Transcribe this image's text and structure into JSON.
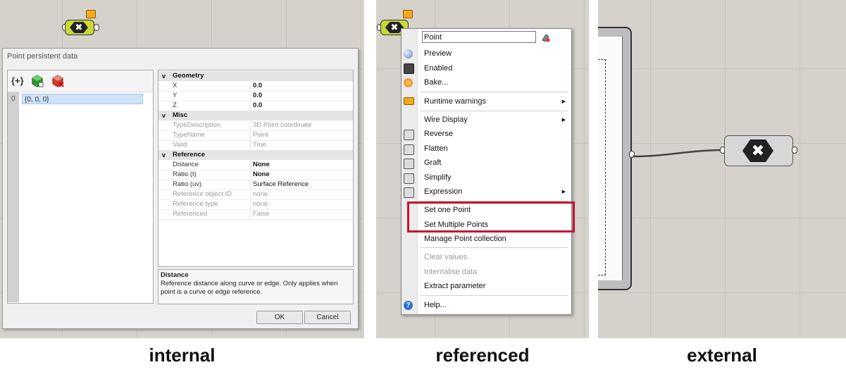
{
  "captions": [
    "internal",
    "referenced",
    "external"
  ],
  "node_glyph": "✖",
  "dialog": {
    "title": "Point persistent data",
    "list_item_index": "0",
    "list_item_value": "{0, 0, 0}",
    "toolbar_icons": [
      "add-braces-icon",
      "green-cube-icon",
      "red-cube-icon"
    ],
    "sections": {
      "geometry": "Geometry",
      "misc": "Misc",
      "reference": "Reference"
    },
    "geometry": [
      {
        "k": "X",
        "v": "0.0"
      },
      {
        "k": "Y",
        "v": "0.0"
      },
      {
        "k": "Z",
        "v": "0.0"
      }
    ],
    "misc": [
      {
        "k": "TypeDescription",
        "v": "3D Point coordinate"
      },
      {
        "k": "TypeName",
        "v": "Point"
      },
      {
        "k": "Valid",
        "v": "True"
      }
    ],
    "reference": [
      {
        "k": "Distance",
        "v": "None"
      },
      {
        "k": "Ratio (t)",
        "v": "None"
      },
      {
        "k": "Ratio (uv)",
        "v": "Surface Reference"
      },
      {
        "k": "Reference object ID",
        "v": "none"
      },
      {
        "k": "Reference type",
        "v": "none"
      },
      {
        "k": "Referenced",
        "v": "False"
      }
    ],
    "desc_title": "Distance",
    "desc_text": "Reference distance along curve or edge. Only applies when point is a curve or edge reference.",
    "ok": "OK",
    "cancel": "Cancel"
  },
  "menu": {
    "name": "Point",
    "items": {
      "preview": "Preview",
      "enabled": "Enabled",
      "bake": "Bake...",
      "runtime": "Runtime warnings",
      "wire": "Wire Display",
      "reverse": "Reverse",
      "flatten": "Flatten",
      "graft": "Graft",
      "simplify": "Simplify",
      "expression": "Expression",
      "set_one": "Set one Point",
      "set_multiple": "Set Multiple Points",
      "manage": "Manage Point collection",
      "clear": "Clear values",
      "internalise": "Internalise data",
      "extract": "Extract parameter",
      "help": "Help..."
    }
  },
  "colors": {
    "highlight": "#c8102e",
    "node_green": "#c7d837",
    "tag_orange": "#f6a81c"
  }
}
